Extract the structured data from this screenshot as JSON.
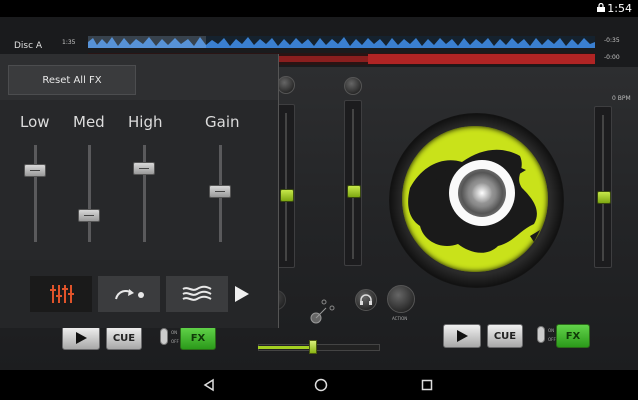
{
  "status_bar": {
    "time": "1:54",
    "lock_icon": "lock-icon"
  },
  "deck_a": {
    "label": "Disc A",
    "elapsed": "1:35",
    "remaining": "-0:35",
    "remaining_b": "-0:00"
  },
  "fx_panel": {
    "reset_label": "Reset All FX",
    "eq": [
      {
        "label": "Low",
        "level": 0.65
      },
      {
        "label": "Med",
        "level": 0.3
      },
      {
        "label": "High",
        "level": 0.78
      },
      {
        "label": "Gain",
        "level": 0.55
      }
    ],
    "tabs": [
      {
        "name": "equalizer",
        "icon": "equalizer-icon",
        "active": true
      },
      {
        "name": "loop",
        "icon": "redo-icon",
        "active": false
      },
      {
        "name": "filter",
        "icon": "waves-icon",
        "active": false
      }
    ],
    "next_icon": "play-arrow-icon"
  },
  "deck_controls": {
    "play_icon": "play-icon",
    "cue_label": "CUE",
    "fx_label": "FX",
    "switch_on": "ON",
    "switch_off": "OFF"
  },
  "bpm_right": "0 BPM",
  "mixer": {
    "action_label": "ACTION",
    "fader_levels": {
      "left_outer": 0.55,
      "left_mid": 0.4,
      "right_outer": 0.45
    },
    "crossfader": 0.45
  },
  "colors": {
    "accent": "#b5dc1a",
    "fx_green": "#3dbb2a",
    "waveform": "#3a7fd0",
    "waveform_red": "#b02424"
  },
  "nav": {
    "back": "back-icon",
    "home": "home-icon",
    "recents": "recents-icon"
  }
}
